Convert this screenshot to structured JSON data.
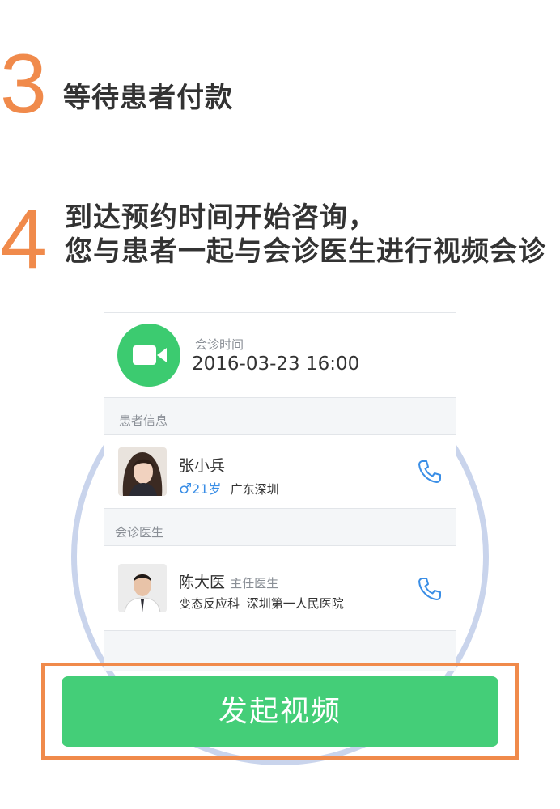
{
  "step3": {
    "number": "3",
    "text": "等待患者付款"
  },
  "step4": {
    "number": "4",
    "line1": "到达预约时间开始咨询，",
    "line2": "您与患者一起与会诊医生进行视频会诊"
  },
  "card": {
    "consult_time_label": "会诊时间",
    "consult_time_value": "2016-03-23 16:00",
    "patient_section_label": "患者信息",
    "patient": {
      "name": "张小兵",
      "gender_symbol": "♂",
      "age": "21岁",
      "location": "广东深圳"
    },
    "doctor_section_label": "会诊医生",
    "doctor": {
      "name": "陈大医",
      "title": "主任医生",
      "department": "变态反应科",
      "hospital": "深圳第一人民医院"
    }
  },
  "action": {
    "start_video_label": "发起视频"
  },
  "colors": {
    "accent_orange": "#f08a4b",
    "green": "#44ce78",
    "blue": "#3a8ee6",
    "ring": "#c9d4ec"
  },
  "icons": [
    "video-camera-icon",
    "phone-icon",
    "male-icon"
  ]
}
